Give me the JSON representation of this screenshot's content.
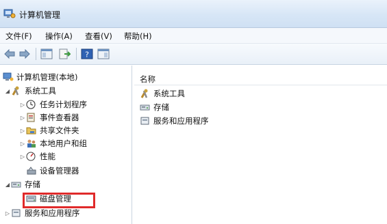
{
  "window": {
    "title": "计算机管理",
    "icon": "computer-management-icon"
  },
  "menu": {
    "items": [
      "文件(F)",
      "操作(A)",
      "查看(V)",
      "帮助(H)"
    ]
  },
  "toolbar": {
    "buttons": [
      "back-arrow-icon",
      "forward-arrow-icon",
      "show-hide-tree-icon",
      "export-list-icon",
      "help-icon",
      "properties-icon"
    ]
  },
  "tree": {
    "root": "计算机管理(本地)",
    "system_tools": "系统工具",
    "task_scheduler": "任务计划程序",
    "event_viewer": "事件查看器",
    "shared_folders": "共享文件夹",
    "local_users_groups": "本地用户和组",
    "performance": "性能",
    "device_manager": "设备管理器",
    "storage": "存储",
    "disk_management": "磁盘管理",
    "services_apps": "服务和应用程序"
  },
  "list": {
    "column_name": "名称",
    "items": [
      "系统工具",
      "存储",
      "服务和应用程序"
    ]
  },
  "colors": {
    "highlight": "#e02a2a",
    "titlebar": "#d7e6f6"
  }
}
